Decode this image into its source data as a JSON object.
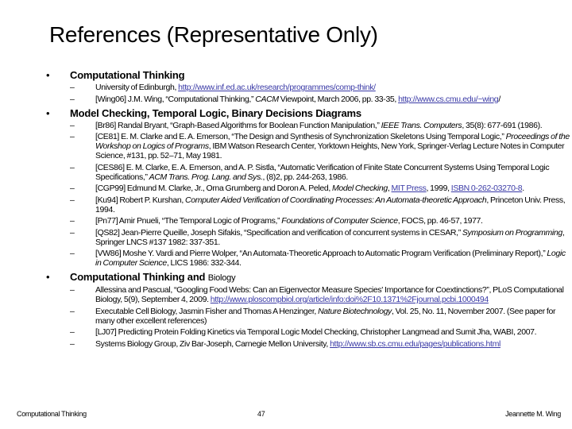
{
  "title": "References (Representative Only)",
  "sections": [
    {
      "heading": "Computational Thinking",
      "items": [
        {
          "parts": [
            {
              "t": "University of Edinburgh, "
            },
            {
              "t": "http://www.inf.ed.ac.uk/research/programmes/comp-think/",
              "link": true
            }
          ]
        },
        {
          "parts": [
            {
              "t": "[Wing06] J.M. Wing, “Computational Thinking,” "
            },
            {
              "t": "CACM",
              "i": true
            },
            {
              "t": " Viewpoint, March 2006, pp. 33-35, "
            },
            {
              "t": "http://www.cs.cmu.edu/~wing",
              "link": true
            },
            {
              "t": "/"
            }
          ]
        }
      ]
    },
    {
      "heading": "Model Checking, Temporal Logic, Binary Decisions Diagrams",
      "items": [
        {
          "parts": [
            {
              "t": "[Br86] Randal Bryant, “Graph-Based Algorithms for Boolean Function Manipulation,” "
            },
            {
              "t": "IEEE Trans. Computers",
              "i": true
            },
            {
              "t": ", 35(8): 677-691 (1986)."
            }
          ]
        },
        {
          "parts": [
            {
              "t": "[CE81] E. M. Clarke and E. A. Emerson, “The Design and Synthesis of Synchronization Skeletons Using Temporal Logic,” "
            },
            {
              "t": "Proceedings of the Workshop on Logics of Programs",
              "i": true
            },
            {
              "t": ", IBM Watson Research Center, Yorktown Heights, New York, Springer-Verlag Lecture Notes in Computer Science, #131, pp. 52–71, May 1981."
            }
          ]
        },
        {
          "parts": [
            {
              "t": "[CES86] E. M. Clarke, E. A. Emerson, and A. P. Sistla, “Automatic Verification of Finite State Concurrent Systems Using Temporal Logic Specifications,” "
            },
            {
              "t": "ACM Trans. Prog. Lang. and Sys.",
              "i": true
            },
            {
              "t": ", (8)2, pp. 244-263, 1986."
            }
          ]
        },
        {
          "parts": [
            {
              "t": "[CGP99] Edmund M. Clarke, Jr., Orna Grumberg and Doron A. Peled, "
            },
            {
              "t": "Model Checking",
              "i": true
            },
            {
              "t": ", "
            },
            {
              "t": "MIT Press",
              "link": true
            },
            {
              "t": ", 1999, "
            },
            {
              "t": "ISBN 0-262-03270-8",
              "link": true
            },
            {
              "t": "."
            }
          ]
        },
        {
          "parts": [
            {
              "t": "[Ku94] Robert P. Kurshan, "
            },
            {
              "t": "Computer Aided Verification of Coordinating Processes: An Automata-theoretic Approach",
              "i": true
            },
            {
              "t": ", Princeton Univ. Press, 1994."
            }
          ]
        },
        {
          "parts": [
            {
              "t": "[Pn77] Amir Pnueli, “The Temporal Logic of Programs,” "
            },
            {
              "t": "Foundations of Computer Science",
              "i": true
            },
            {
              "t": ", FOCS, pp. 46-57, 1977."
            }
          ]
        },
        {
          "parts": [
            {
              "t": "[QS82] Jean-Pierre Queille, Joseph Sifakis, “Specification and verification of concurrent systems in CESAR,” "
            },
            {
              "t": "Symposium on Programming",
              "i": true
            },
            {
              "t": ", Springer LNCS #137 1982: 337-351."
            }
          ]
        },
        {
          "parts": [
            {
              "t": "[VW86] Moshe Y. Vardi and Pierre Wolper, “An Automata-Theoretic Approach to Automatic Program Verification (Preliminary Report),” "
            },
            {
              "t": "Logic in Computer Science",
              "i": true
            },
            {
              "t": ", LICS 1986: 332-344."
            }
          ]
        }
      ]
    },
    {
      "heading": "Computational Thinking",
      "heading_normal": " and ",
      "heading_small": "Biology",
      "items": [
        {
          "parts": [
            {
              "t": "Allessina and Pascual, “Googling Food Webs: Can an Eigenvector Measure Species' Importance for Coextinctions?”, PLoS Computational Biology, 5(9), September 4, 2009. "
            },
            {
              "t": "http://www.ploscompbiol.org/article/info:doi%2F10.1371%2Fjournal.pcbi.1000494",
              "link": true
            }
          ]
        },
        {
          "parts": [
            {
              "t": "Executable Cell Biology, Jasmin Fisher and Thomas A Henzinger, "
            },
            {
              "t": "Nature Biotechnology",
              "i": true
            },
            {
              "t": ", Vol. 25, No. 11, November 2007. (See paper for many other excellent references)"
            }
          ]
        },
        {
          "parts": [
            {
              "t": "[LJ07] Predicting Protein Folding Kinetics via Temporal Logic Model Checking, Christopher Langmead and Sumit Jha, WABI, 2007."
            }
          ]
        },
        {
          "parts": [
            {
              "t": "Systems Biology Group, Ziv Bar-Joseph, Carnegie Mellon University, "
            },
            {
              "t": "http://www.sb.cs.cmu.edu/pages/publications.html",
              "link": true
            }
          ]
        }
      ]
    }
  ],
  "bullet": "•",
  "dash": "–",
  "footer": {
    "left": "Computational Thinking",
    "center": "47",
    "right": "Jeannette M. Wing"
  }
}
